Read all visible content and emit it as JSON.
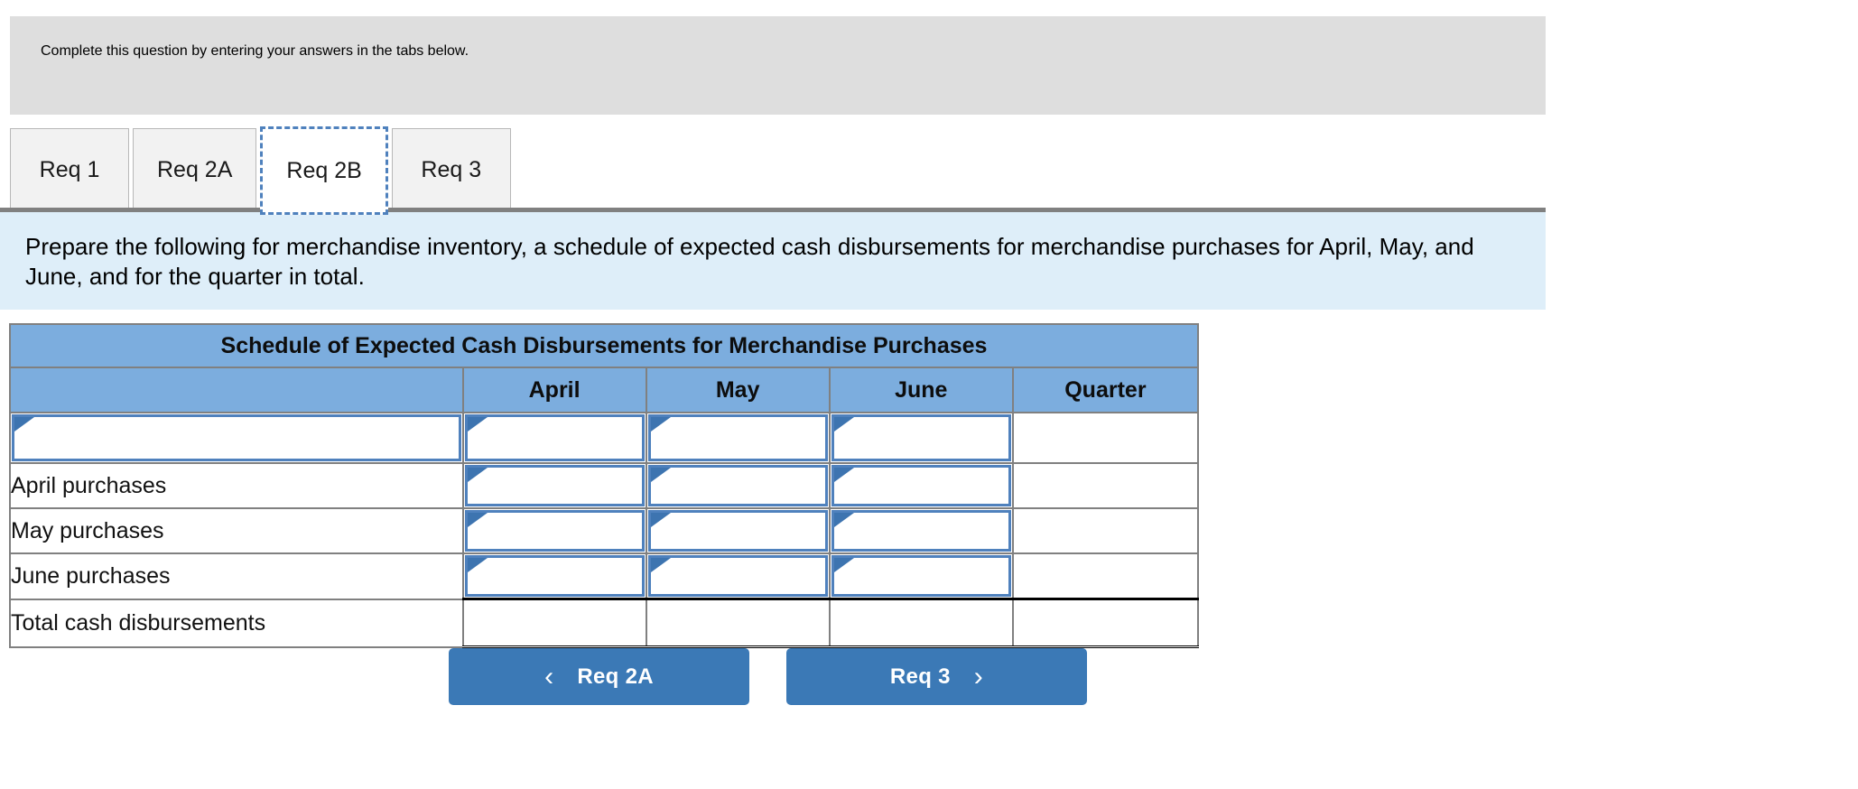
{
  "question_banner": {
    "text": "Complete this question by entering your answers in the tabs below."
  },
  "tabs": [
    {
      "label": "Req 1",
      "selected": false
    },
    {
      "label": "Req 2A",
      "selected": false
    },
    {
      "label": "Req 2B",
      "selected": true
    },
    {
      "label": "Req 3",
      "selected": false
    }
  ],
  "requirement": {
    "text": "Prepare the following for merchandise inventory, a schedule of expected cash disbursements for merchandise purchases for April, May, and June, and for the quarter in total."
  },
  "worksheet": {
    "title": "Schedule of Expected Cash Disbursements for Merchandise Purchases",
    "columns": [
      "",
      "April",
      "May",
      "June",
      "Quarter"
    ],
    "rows": [
      {
        "label": "",
        "label_editable": true,
        "cells": [
          {
            "value": "",
            "editable": true
          },
          {
            "value": "",
            "editable": true
          },
          {
            "value": "",
            "editable": true
          },
          {
            "value": "",
            "editable": false
          }
        ]
      },
      {
        "label": "April purchases",
        "label_editable": false,
        "cells": [
          {
            "value": "",
            "editable": true
          },
          {
            "value": "",
            "editable": true
          },
          {
            "value": "",
            "editable": true
          },
          {
            "value": "",
            "editable": false
          }
        ]
      },
      {
        "label": "May purchases",
        "label_editable": false,
        "cells": [
          {
            "value": "",
            "editable": true
          },
          {
            "value": "",
            "editable": true
          },
          {
            "value": "",
            "editable": true
          },
          {
            "value": "",
            "editable": false
          }
        ]
      },
      {
        "label": "June purchases",
        "label_editable": false,
        "cells": [
          {
            "value": "",
            "editable": true
          },
          {
            "value": "",
            "editable": true
          },
          {
            "value": "",
            "editable": true
          },
          {
            "value": "",
            "editable": false
          }
        ]
      }
    ],
    "total_row": {
      "label": "Total cash disbursements",
      "cells": [
        {
          "value": ""
        },
        {
          "value": ""
        },
        {
          "value": ""
        },
        {
          "value": ""
        }
      ]
    }
  },
  "navigation": {
    "prev_label": "Req 2A",
    "prev_icon": "chevron-left-icon",
    "prev_glyph": "‹",
    "next_label": "Req 3",
    "next_icon": "chevron-right-icon",
    "next_glyph": "›"
  },
  "colors": {
    "banner_gray": "#dedede",
    "requirement_blue": "#deeef9",
    "table_header_blue": "#7cadde",
    "input_border_blue": "#4f81bd",
    "button_blue": "#3b79b6",
    "tab_inactive": "#f2f2f2",
    "grid_gray": "#808080"
  }
}
